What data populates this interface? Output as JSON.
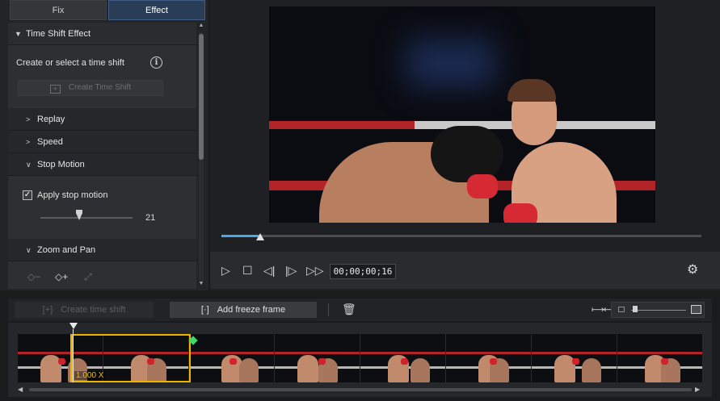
{
  "tabs": [
    {
      "label": "Fix",
      "active": false
    },
    {
      "label": "Effect",
      "active": true
    }
  ],
  "time_shift": {
    "title": "Time Shift Effect",
    "prompt": "Create or select a time shift",
    "info_icon": "info-circle-icon",
    "create_button": "Create Time Shift"
  },
  "sections": {
    "replay": "Replay",
    "speed": "Speed",
    "stop_motion": "Stop Motion",
    "zoom_pan": "Zoom and Pan"
  },
  "stop_motion": {
    "checkbox_label": "Apply stop motion",
    "checked": true,
    "slider_value": "21",
    "slider_fraction": 0.42
  },
  "player": {
    "timecode": "00;00;00;16",
    "seek_fraction": 0.08
  },
  "timeline_toolbar": {
    "create_time_shift": "Create time shift",
    "add_freeze_frame": "Add freeze frame"
  },
  "timeline": {
    "selection_label": "1.000 X"
  },
  "colors": {
    "accent_blue": "#4aa8e8",
    "selection_yellow": "#f0b400",
    "marker_green": "#3ddc6a"
  }
}
